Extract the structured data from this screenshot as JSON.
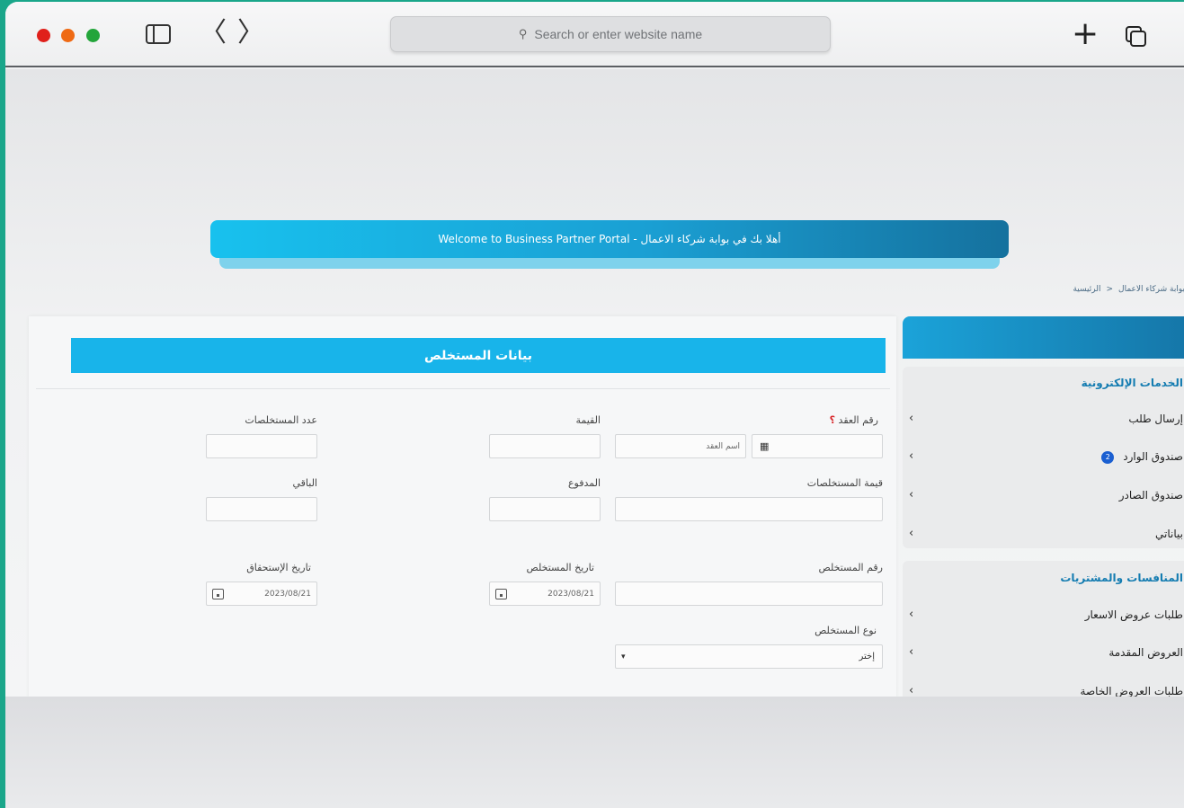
{
  "browser": {
    "address_placeholder": "Search or enter website name",
    "back_glyph": "〈",
    "forward_glyph": "〉",
    "new_tab_glyph": "+"
  },
  "banner": {
    "text": "Welcome to Business Partner Portal - أهلا بك في بوابة شركاء الاعمال"
  },
  "breadcrumb": {
    "home": "الرئيسية",
    "separator": "<",
    "current": "بوابة شركاء الاعمال"
  },
  "form": {
    "title": "بيانات المستخلص",
    "contract_number": {
      "label": "رقم العقد",
      "required_mark": "؟",
      "placeholder": "اسم العقد"
    },
    "value": {
      "label": "القيمة"
    },
    "count": {
      "label": "عدد المستخلصات"
    },
    "extracts_value": {
      "label": "قيمة المستخلصات"
    },
    "paid": {
      "label": "المدفوع"
    },
    "remaining": {
      "label": "الباقي"
    },
    "extract_number": {
      "label": "رقم المستخلص"
    },
    "extract_date": {
      "label": "تاريخ المستخلص",
      "value": "2023/08/21"
    },
    "due_date": {
      "label": "تاريخ الإستحقاق",
      "value": "2023/08/21"
    },
    "extract_type": {
      "label": "نوع المستخلص",
      "value": "إختر"
    }
  },
  "sidebar": {
    "groups": [
      {
        "title": "الخدمات الإلكترونية",
        "items": [
          {
            "label": "إرسال طلب"
          },
          {
            "label": "صندوق الوارد",
            "badge": "2"
          },
          {
            "label": "صندوق الصادر"
          },
          {
            "label": "بياناتي"
          }
        ]
      },
      {
        "title": "المنافسات والمشتريات",
        "items": [
          {
            "label": "طلبات عروض الاسعار"
          },
          {
            "label": "العروض المقدمة"
          },
          {
            "label": "طلبات العروض الخاصة"
          }
        ]
      }
    ],
    "chevron_glyph": "‹"
  },
  "colors": {
    "accent": "#18b4ea",
    "sidebar_title": "#147cb1",
    "frame": "#1aa68a"
  }
}
